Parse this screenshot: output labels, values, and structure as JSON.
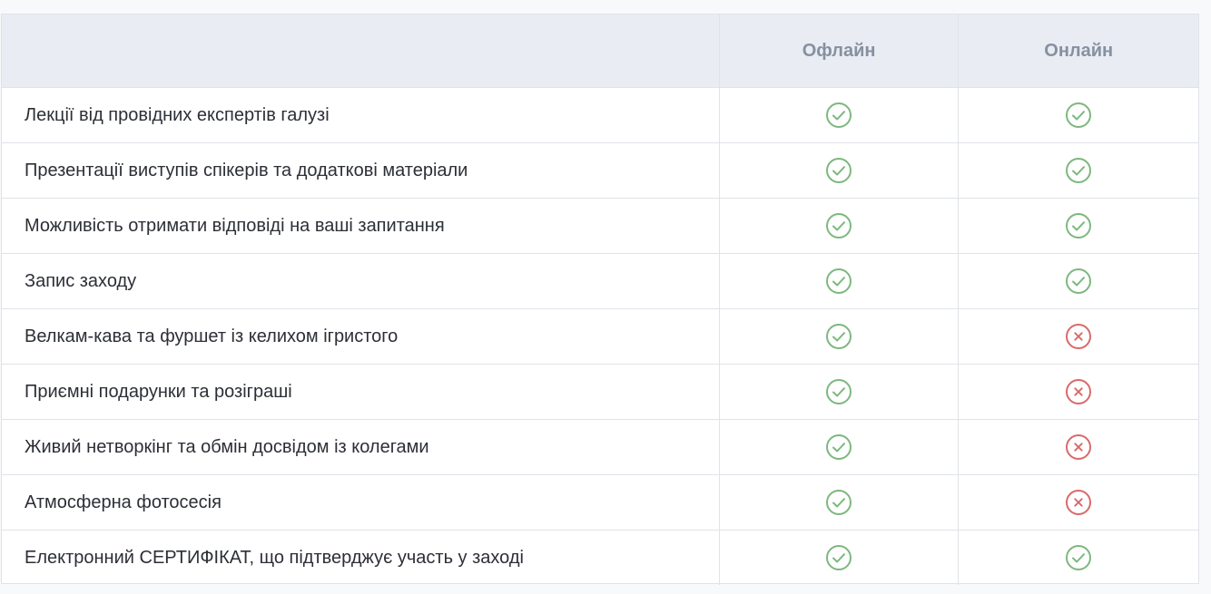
{
  "table": {
    "columns": [
      "Офлайн",
      "Онлайн"
    ],
    "rows": [
      {
        "feature": "Лекції від провідних експертів галузі",
        "offline": "check",
        "online": "check"
      },
      {
        "feature": "Презентації виступів спікерів та додаткові матеріали",
        "offline": "check",
        "online": "check"
      },
      {
        "feature": "Можливість отримати відповіді на ваші запитання",
        "offline": "check",
        "online": "check"
      },
      {
        "feature": "Запис заходу",
        "offline": "check",
        "online": "check"
      },
      {
        "feature": "Велкам-кава та фуршет із келихом ігристого",
        "offline": "check",
        "online": "cross"
      },
      {
        "feature": "Приємні подарунки та розіграші",
        "offline": "check",
        "online": "cross"
      },
      {
        "feature": "Живий нетворкінг та обмін досвідом із колегами",
        "offline": "check",
        "online": "cross"
      },
      {
        "feature": "Атмосферна фотосесія",
        "offline": "check",
        "online": "cross"
      },
      {
        "feature": "Електронний СЕРТИФІКАТ, що підтверджує участь у заході",
        "offline": "check",
        "online": "check"
      }
    ]
  },
  "colors": {
    "check": "#7db87e",
    "cross": "#d96a6a"
  },
  "icons": {
    "check": "check-circle-icon",
    "cross": "cross-circle-icon"
  }
}
